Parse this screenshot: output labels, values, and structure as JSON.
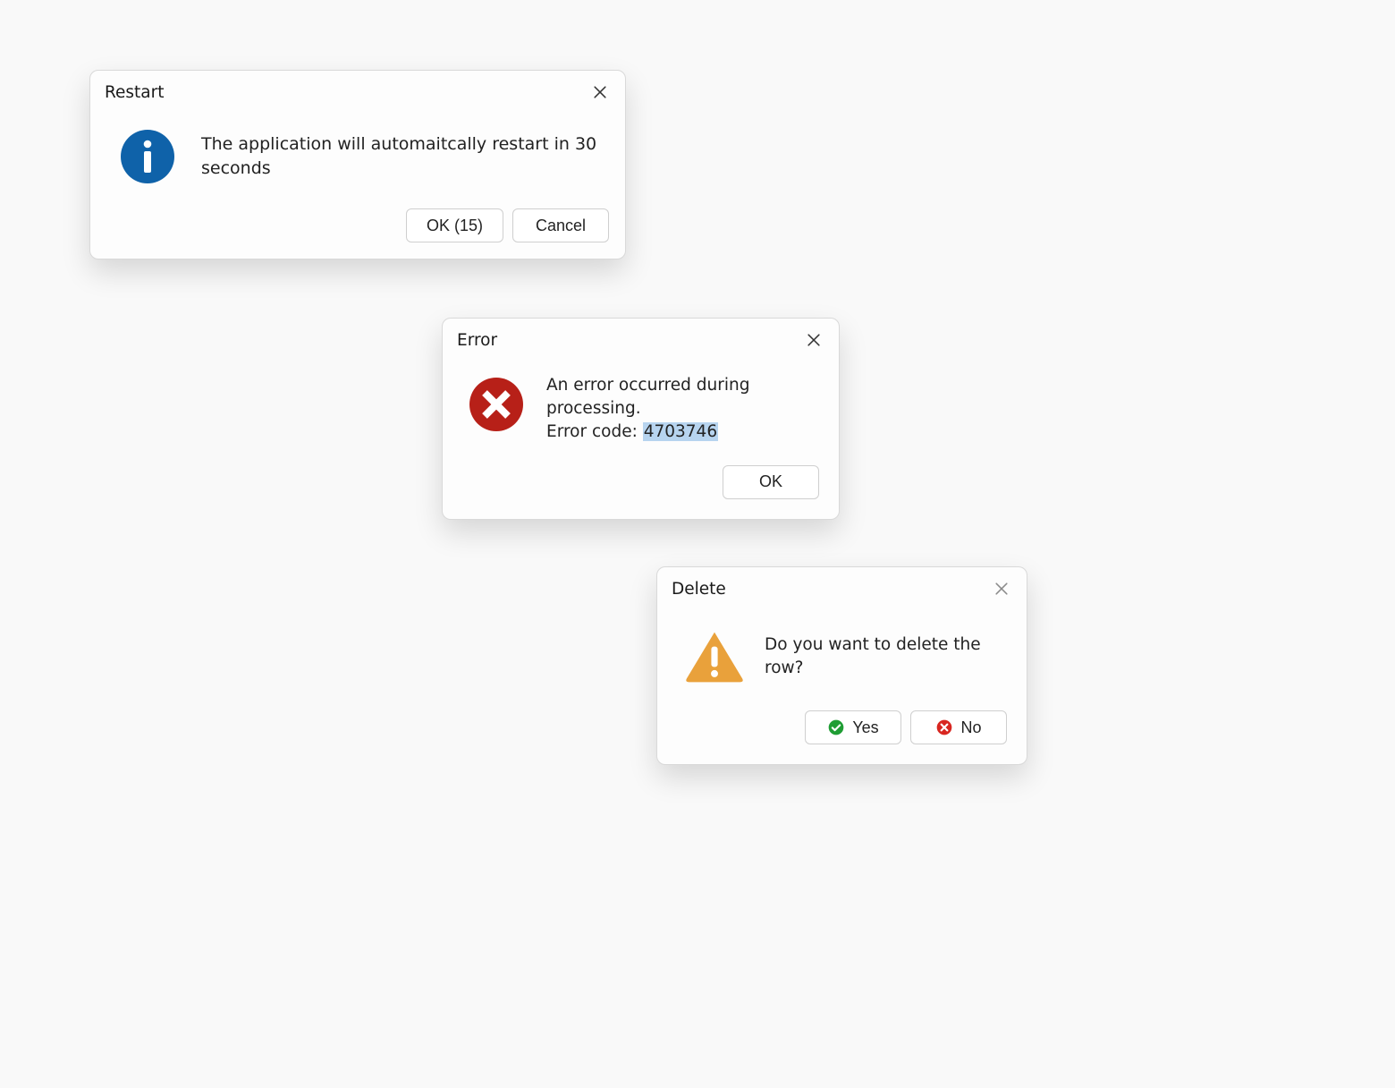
{
  "dialogs": {
    "restart": {
      "title": "Restart",
      "message": "The application will automaitcally restart in 30 seconds",
      "buttons": {
        "ok": "OK (15)",
        "cancel": "Cancel"
      }
    },
    "error": {
      "title": "Error",
      "message_line1": "An error occurred during processing.",
      "message_line2_label": "Error code: ",
      "message_line2_code": "4703746",
      "buttons": {
        "ok": "OK"
      }
    },
    "delete": {
      "title": "Delete",
      "message": "Do you want to delete the row?",
      "buttons": {
        "yes": "Yes",
        "no": "No"
      }
    }
  },
  "colors": {
    "info_blue": "#0f62a9",
    "error_red": "#b72018",
    "warn_amber": "#e9a13b",
    "yes_green": "#1f9d34",
    "no_red": "#d82620",
    "highlight": "#b7d4ef"
  }
}
